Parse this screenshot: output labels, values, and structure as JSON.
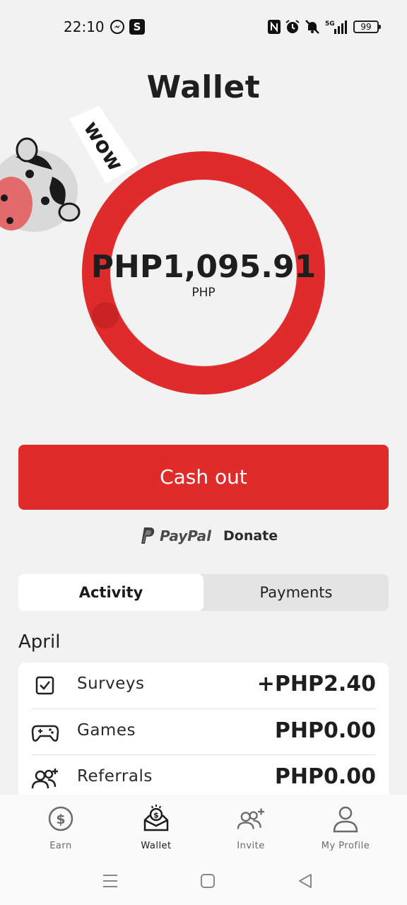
{
  "status_bar": {
    "time": "22:10",
    "app_badge": "S",
    "battery": "99",
    "icons": [
      "messenger-icon",
      "s-app-icon",
      "nfc-icon",
      "alarm-icon",
      "mute-icon",
      "5g-signal-icon",
      "battery-icon"
    ]
  },
  "header": {
    "title": "Wallet"
  },
  "mascot": {
    "speech": "wow"
  },
  "balance": {
    "amount": "PHP1,095.91",
    "currency": "PHP",
    "ring_color": "#df2b2b"
  },
  "cashout": {
    "label": "Cash out",
    "color": "#e02b2b"
  },
  "partners": {
    "paypal": "PayPal",
    "donate": "Donate"
  },
  "tabs": [
    {
      "label": "Activity",
      "active": true
    },
    {
      "label": "Payments",
      "active": false
    }
  ],
  "activity": {
    "month": "April",
    "rows": [
      {
        "icon": "checkbox-icon",
        "label": "Surveys",
        "value": "+PHP2.40"
      },
      {
        "icon": "gamepad-icon",
        "label": "Games",
        "value": "PHP0.00"
      },
      {
        "icon": "referrals-icon",
        "label": "Referrals",
        "value": "PHP0.00"
      }
    ]
  },
  "bottom_nav": [
    {
      "icon": "dollar-coin-icon",
      "label": "Earn",
      "active": false
    },
    {
      "icon": "wallet-icon",
      "label": "Wallet",
      "active": true
    },
    {
      "icon": "invite-icon",
      "label": "Invite",
      "active": false
    },
    {
      "icon": "profile-icon",
      "label": "My Profile",
      "active": false
    }
  ]
}
